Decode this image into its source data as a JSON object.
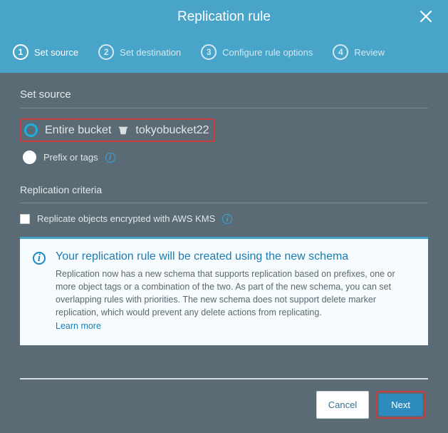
{
  "header": {
    "title": "Replication rule"
  },
  "wizard": {
    "steps": [
      {
        "num": "1",
        "label": "Set source"
      },
      {
        "num": "2",
        "label": "Set destination"
      },
      {
        "num": "3",
        "label": "Configure rule options"
      },
      {
        "num": "4",
        "label": "Review"
      }
    ]
  },
  "source": {
    "section_title": "Set source",
    "entire_bucket_label": "Entire bucket",
    "bucket_name": "tokyobucket22",
    "prefix_label": "Prefix or tags"
  },
  "criteria": {
    "title": "Replication criteria",
    "kms_label": "Replicate objects encrypted with AWS KMS"
  },
  "info_panel": {
    "title": "Your replication rule will be created using the new schema",
    "body": "Replication now has a new schema that supports replication based on prefixes, one or more object tags or a combination of the two. As part of the new schema, you can set overlapping rules with priorities. The new schema does not support delete marker replication, which would prevent any delete actions from replicating.",
    "learn_more": "Learn more"
  },
  "footer": {
    "cancel": "Cancel",
    "next": "Next"
  }
}
